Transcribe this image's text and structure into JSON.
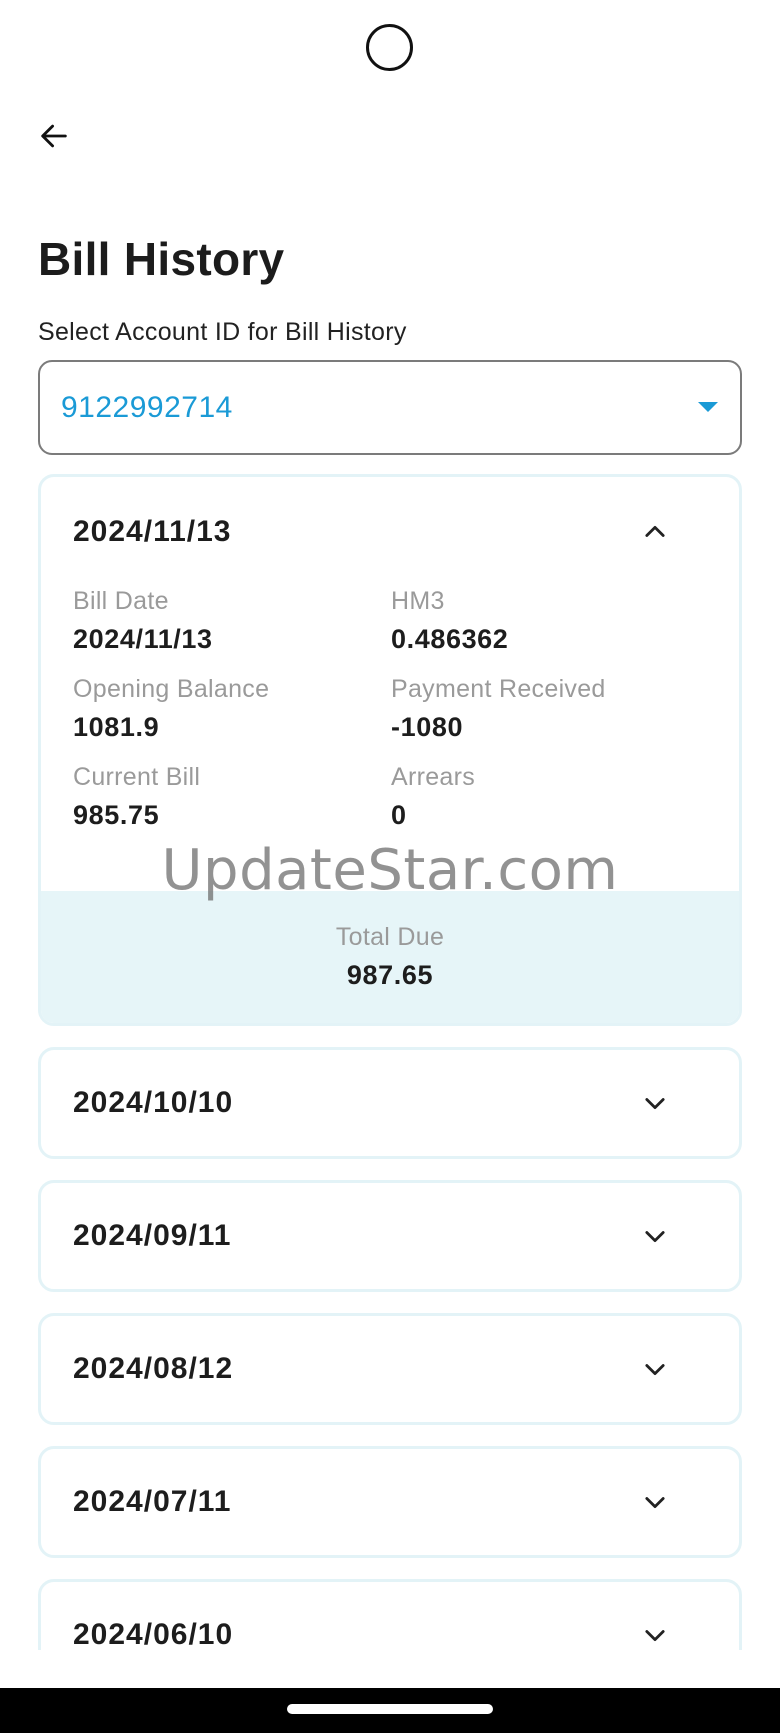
{
  "header": {
    "back_icon": "arrow-left-icon",
    "title": "Bill History"
  },
  "account_select": {
    "label": "Select Account ID for Bill History",
    "value": "9122992714",
    "accent_color": "#1a9ad6"
  },
  "bills": [
    {
      "date": "2024/11/13",
      "expanded": true,
      "fields": [
        {
          "label": "Bill Date",
          "value": "2024/11/13"
        },
        {
          "label": "HM3",
          "value": "0.486362"
        },
        {
          "label": "Opening Balance",
          "value": "1081.9"
        },
        {
          "label": "Payment Received",
          "value": "-1080"
        },
        {
          "label": "Current Bill",
          "value": "985.75"
        },
        {
          "label": "Arrears",
          "value": "0"
        }
      ],
      "total_label": "Total Due",
      "total_value": "987.65"
    },
    {
      "date": "2024/10/10",
      "expanded": false
    },
    {
      "date": "2024/09/11",
      "expanded": false
    },
    {
      "date": "2024/08/12",
      "expanded": false
    },
    {
      "date": "2024/07/11",
      "expanded": false
    },
    {
      "date": "2024/06/10",
      "expanded": false
    }
  ],
  "watermark": "UpdateStar.com",
  "colors": {
    "card_border": "#e3f3f7",
    "total_background": "#e6f5f8"
  }
}
